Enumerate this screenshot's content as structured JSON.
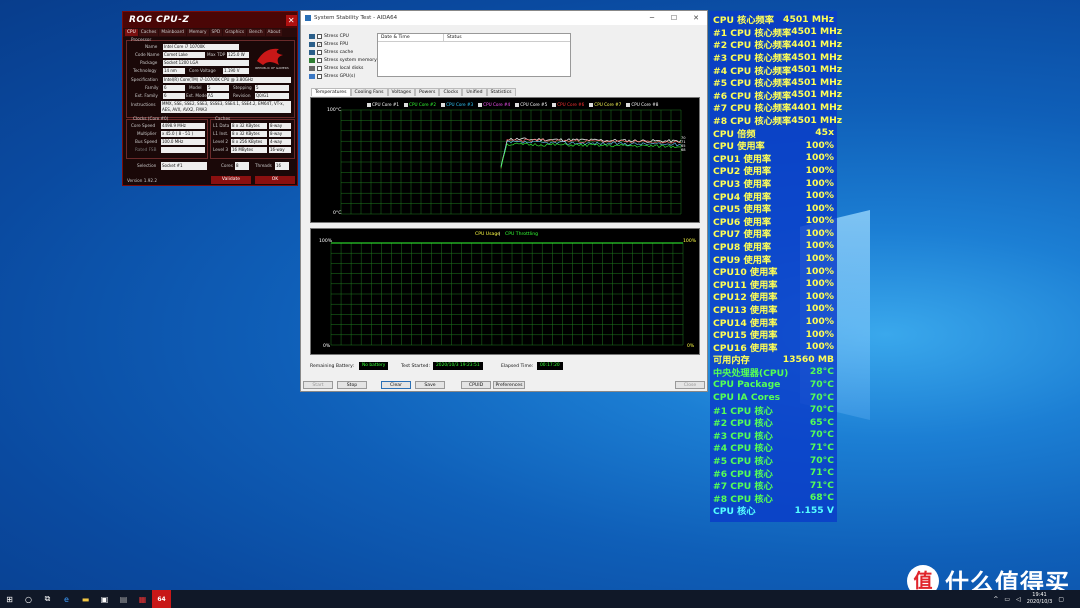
{
  "cpuz": {
    "title": "ROG CPU-Z",
    "tabs": [
      "CPU",
      "Caches",
      "Mainboard",
      "Memory",
      "SPD",
      "Graphics",
      "Bench",
      "About"
    ],
    "processor_group": "Processor",
    "fields": [
      {
        "label": "Name",
        "value": "Intel Core i7 10700K"
      },
      {
        "label": "Code Name",
        "value": "Comet Lake"
      },
      {
        "label": "Max TDP",
        "value": "125.0 W"
      },
      {
        "label": "Package",
        "value": "Socket 1200 LGA"
      },
      {
        "label": "Technology",
        "value": "14 nm"
      },
      {
        "label": "Core Voltage",
        "value": "1.190 V"
      },
      {
        "label": "Specification",
        "value": "Intel(R) Core(TM) i7-10700K CPU @ 3.80GHz"
      },
      {
        "label": "Family",
        "value": "6"
      },
      {
        "label": "Model",
        "value": "5"
      },
      {
        "label": "Stepping",
        "value": "5"
      },
      {
        "label": "Ext. Family",
        "value": "6"
      },
      {
        "label": "Ext. Model",
        "value": "A5"
      },
      {
        "label": "Revision",
        "value": "Q0/G1"
      },
      {
        "label": "Instructions",
        "value": "MMX, SSE, SSE2, SSE3, SSSE3, SSE4.1, SSE4.2, EM64T, VT-x, AES, AVX, AVX2, FMA3"
      }
    ],
    "clocks_group": "Clocks (Core #0)",
    "caches_group": "Caches",
    "clocks": [
      {
        "label": "Core Speed",
        "value": "4498.9 MHz"
      },
      {
        "label": "Multiplier",
        "value": "x 45.0 ( 8 - 51 )"
      },
      {
        "label": "Bus Speed",
        "value": "100.0 MHz"
      },
      {
        "label": "Rated FSB",
        "value": ""
      }
    ],
    "caches": [
      {
        "label": "L1 Data",
        "value": "8 x 32 KBytes",
        "way": "8-way"
      },
      {
        "label": "L1 Inst.",
        "value": "8 x 32 KBytes",
        "way": "8-way"
      },
      {
        "label": "Level 2",
        "value": "8 x 256 KBytes",
        "way": "4-way"
      },
      {
        "label": "Level 3",
        "value": "16 MBytes",
        "way": "16-way"
      }
    ],
    "selection_label": "Selection",
    "selection_value": "Socket #1",
    "cores_label": "Cores",
    "cores_value": "8",
    "threads_label": "Threads",
    "threads_value": "16",
    "version": "Version 1.92.2",
    "validate": "Validate",
    "ok": "OK",
    "logo_text": "REPUBLIC OF GAMERS"
  },
  "aida": {
    "title": "System Stability Test - AIDA64",
    "checks": [
      {
        "label": "Stress CPU",
        "checked": false
      },
      {
        "label": "Stress FPU",
        "checked": true
      },
      {
        "label": "Stress cache",
        "checked": false
      },
      {
        "label": "Stress system memory",
        "checked": false
      },
      {
        "label": "Stress local disks",
        "checked": false
      },
      {
        "label": "Stress GPU(s)",
        "checked": false
      }
    ],
    "log_headers": [
      "Date & Time",
      "Status"
    ],
    "tabs": [
      "Temperatures",
      "Cooling Fans",
      "Voltages",
      "Powers",
      "Clocks",
      "Unified",
      "Statistics"
    ],
    "legend": [
      "CPU Core #1",
      "CPU Core #2",
      "CPU Core #3",
      "CPU Core #4",
      "CPU Core #5",
      "CPU Core #6",
      "CPU Core #7",
      "CPU Core #8"
    ],
    "legend_colors": [
      "#ffffff",
      "#33ff33",
      "#33ccff",
      "#ff55ff",
      "#ffffff",
      "#ff3333",
      "#ffff55",
      "#ffffff"
    ],
    "temp_top": "100°C",
    "temp_bottom": "0°C",
    "temp_right": [
      "70",
      "71",
      "65",
      "68"
    ],
    "usage_title_a": "CPU Usage",
    "usage_sep": "|",
    "usage_title_b": "CPU Throttling",
    "usage_top": "100%",
    "usage_bottom": "0%",
    "usage_right_top": "100%",
    "usage_right_bottom": "0%",
    "battery_label": "Remaining Battery:",
    "battery_value": "No battery",
    "started_label": "Test Started:",
    "started_value": "2020/10/3 19:23:51",
    "elapsed_label": "Elapsed Time:",
    "elapsed_value": "00:17:20",
    "buttons": [
      "Start",
      "Stop",
      "Clear",
      "Save",
      "CPUID",
      "Preferences",
      "Close"
    ]
  },
  "monitor": [
    {
      "k": "CPU 核心频率",
      "v": "4501 MHz",
      "c": "y"
    },
    {
      "k": "#1 CPU 核心频率",
      "v": "4501 MHz",
      "c": "y"
    },
    {
      "k": "#2 CPU 核心频率",
      "v": "4401 MHz",
      "c": "y"
    },
    {
      "k": "#3 CPU 核心频率",
      "v": "4501 MHz",
      "c": "y"
    },
    {
      "k": "#4 CPU 核心频率",
      "v": "4501 MHz",
      "c": "y"
    },
    {
      "k": "#5 CPU 核心频率",
      "v": "4501 MHz",
      "c": "y"
    },
    {
      "k": "#6 CPU 核心频率",
      "v": "4501 MHz",
      "c": "y"
    },
    {
      "k": "#7 CPU 核心频率",
      "v": "4401 MHz",
      "c": "y"
    },
    {
      "k": "#8 CPU 核心频率",
      "v": "4501 MHz",
      "c": "y"
    },
    {
      "k": "CPU 倍频",
      "v": "45x",
      "c": "y"
    },
    {
      "k": "CPU 使用率",
      "v": "100%",
      "c": "y"
    },
    {
      "k": "CPU1 使用率",
      "v": "100%",
      "c": "y"
    },
    {
      "k": "CPU2 使用率",
      "v": "100%",
      "c": "y"
    },
    {
      "k": "CPU3 使用率",
      "v": "100%",
      "c": "y"
    },
    {
      "k": "CPU4 使用率",
      "v": "100%",
      "c": "y"
    },
    {
      "k": "CPU5 使用率",
      "v": "100%",
      "c": "y"
    },
    {
      "k": "CPU6 使用率",
      "v": "100%",
      "c": "y"
    },
    {
      "k": "CPU7 使用率",
      "v": "100%",
      "c": "y"
    },
    {
      "k": "CPU8 使用率",
      "v": "100%",
      "c": "y"
    },
    {
      "k": "CPU9 使用率",
      "v": "100%",
      "c": "y"
    },
    {
      "k": "CPU10 使用率",
      "v": "100%",
      "c": "y"
    },
    {
      "k": "CPU11 使用率",
      "v": "100%",
      "c": "y"
    },
    {
      "k": "CPU12 使用率",
      "v": "100%",
      "c": "y"
    },
    {
      "k": "CPU13 使用率",
      "v": "100%",
      "c": "y"
    },
    {
      "k": "CPU14 使用率",
      "v": "100%",
      "c": "y"
    },
    {
      "k": "CPU15 使用率",
      "v": "100%",
      "c": "y"
    },
    {
      "k": "CPU16 使用率",
      "v": "100%",
      "c": "y"
    },
    {
      "k": "可用内存",
      "v": "13560 MB",
      "c": "y"
    },
    {
      "k": "中央处理器(CPU)",
      "v": "28°C",
      "c": "c"
    },
    {
      "k": "CPU Package",
      "v": "70°C",
      "c": "c"
    },
    {
      "k": "CPU IA Cores",
      "v": "70°C",
      "c": "c"
    },
    {
      "k": " #1 CPU 核心",
      "v": "70°C",
      "c": "c"
    },
    {
      "k": " #2 CPU 核心",
      "v": "65°C",
      "c": "c"
    },
    {
      "k": " #3 CPU 核心",
      "v": "70°C",
      "c": "c"
    },
    {
      "k": " #4 CPU 核心",
      "v": "71°C",
      "c": "c"
    },
    {
      "k": " #5 CPU 核心",
      "v": "70°C",
      "c": "c"
    },
    {
      "k": " #6 CPU 核心",
      "v": "71°C",
      "c": "c"
    },
    {
      "k": " #7 CPU 核心",
      "v": "71°C",
      "c": "c"
    },
    {
      "k": " #8 CPU 核心",
      "v": "68°C",
      "c": "c"
    },
    {
      "k": "CPU 核心",
      "v": "1.155 V",
      "c": "t"
    }
  ],
  "taskbar": {
    "time": "19:41",
    "date": "2020/10/3",
    "app_badge": "64"
  },
  "watermark": {
    "logo": "值",
    "text": "什么值得买"
  }
}
